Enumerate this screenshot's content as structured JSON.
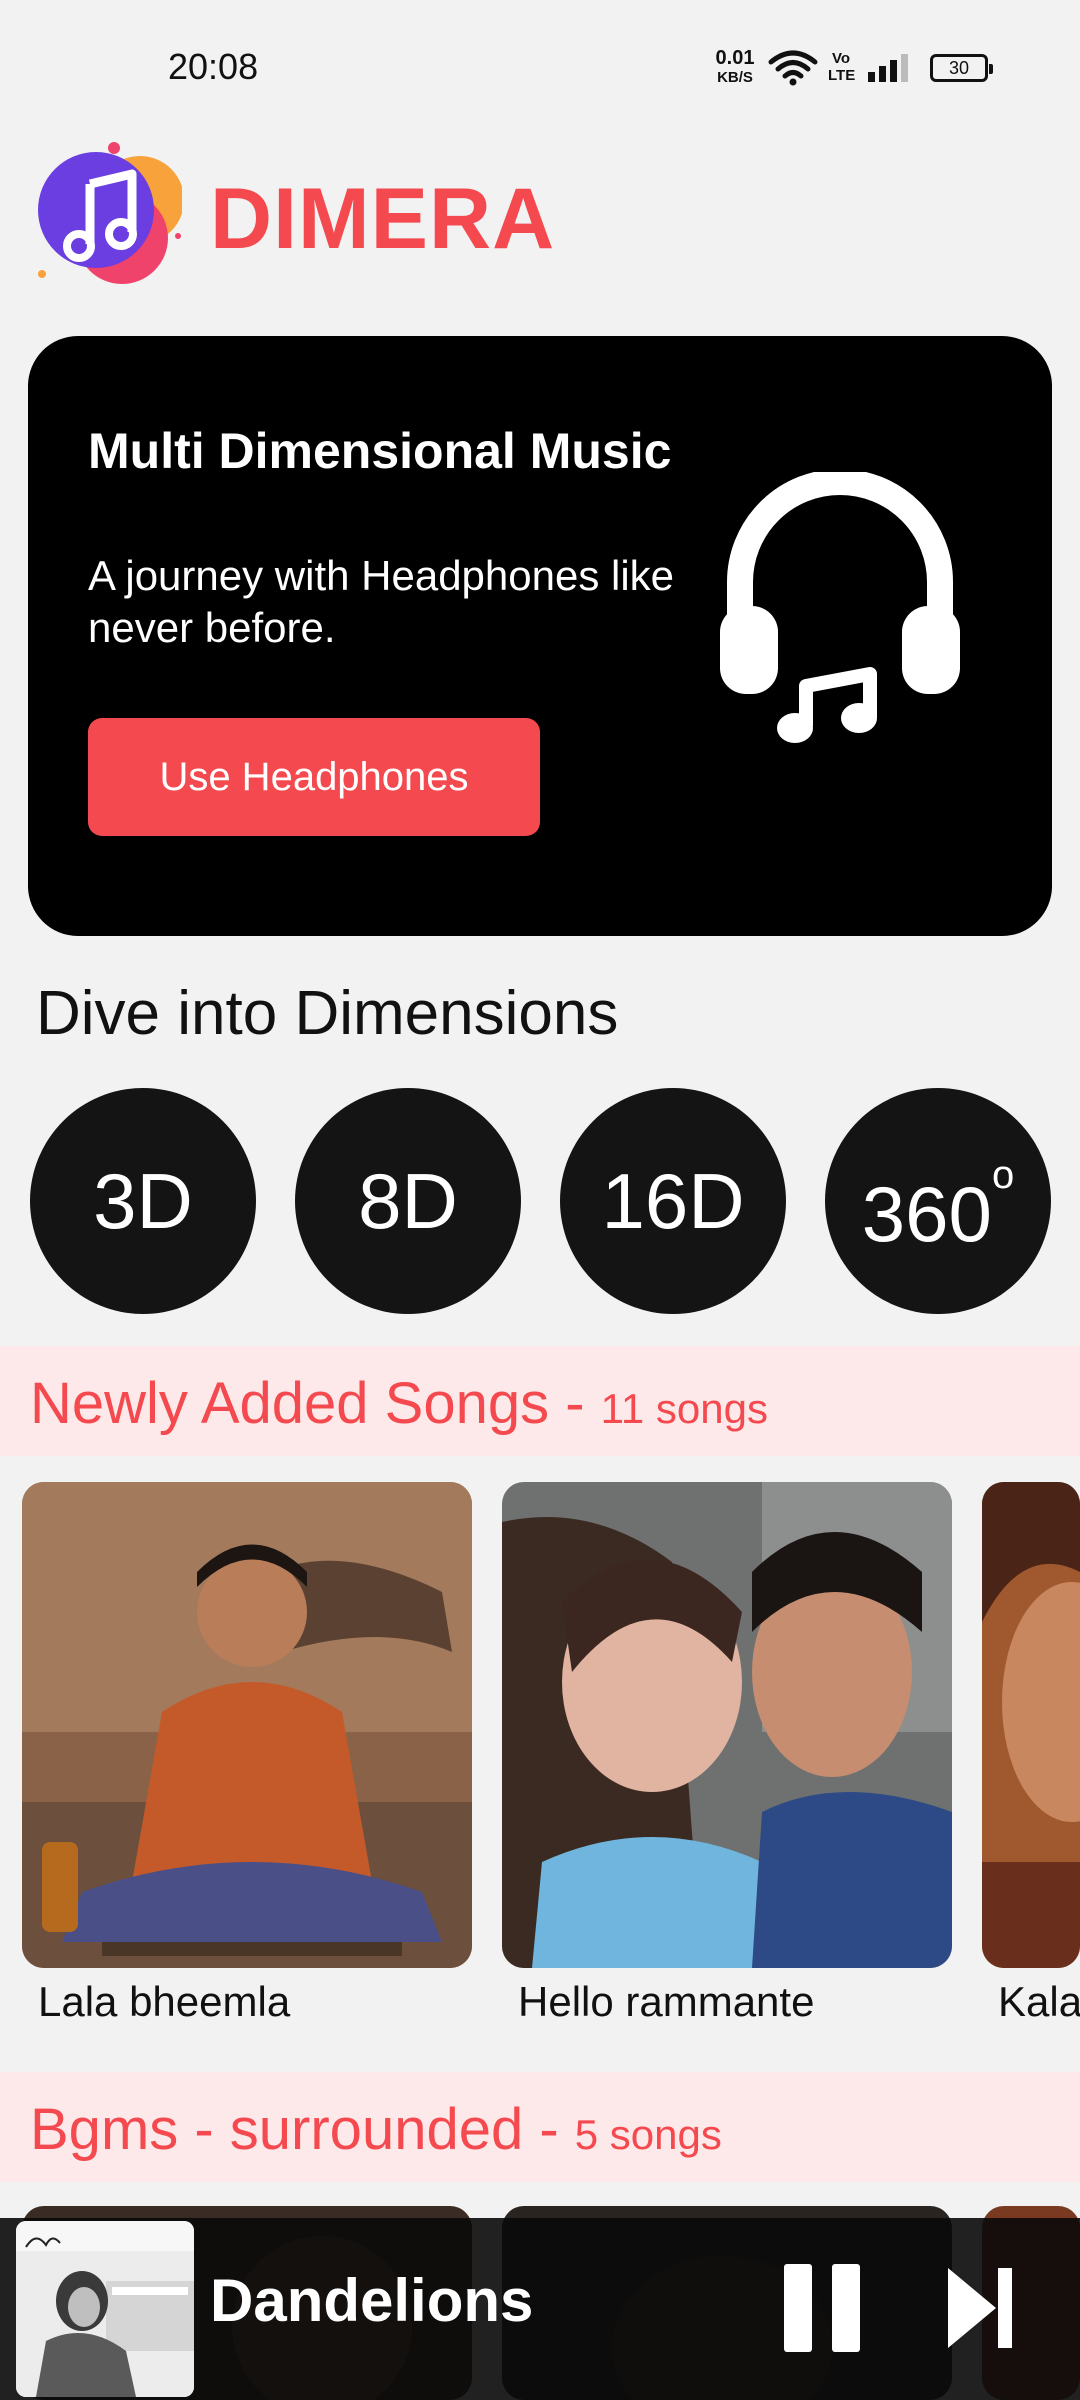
{
  "status_bar": {
    "time": "20:08",
    "net_speed": "0.01",
    "net_speed_unit": "KB/S",
    "volte_label": "Vo LTE",
    "battery": "30"
  },
  "header": {
    "app_name": "DIMERA"
  },
  "hero": {
    "title": "Multi Dimensional Music",
    "subtitle": "A journey with Headphones like never before.",
    "button_label": "Use Headphones",
    "icon": "headphones-music-icon"
  },
  "dimensions": {
    "title": "Dive into Dimensions",
    "items": [
      {
        "label": "3D"
      },
      {
        "label": "8D"
      },
      {
        "label": "16D"
      },
      {
        "label": "360",
        "suffix": "o"
      }
    ]
  },
  "sections": [
    {
      "title": "Newly Added Songs - ",
      "count": "11 songs",
      "songs": [
        {
          "label": "Lala bheemla"
        },
        {
          "label": "Hello rammante"
        },
        {
          "label": "Kala"
        }
      ]
    },
    {
      "title": "Bgms - surrounded - ",
      "count": "5 songs"
    }
  ],
  "now_playing": {
    "title": "Dandelions"
  },
  "colors": {
    "accent": "#f44a4f",
    "section_bg": "#fde9e9",
    "background": "#f2f2f2",
    "dark": "#141414"
  }
}
